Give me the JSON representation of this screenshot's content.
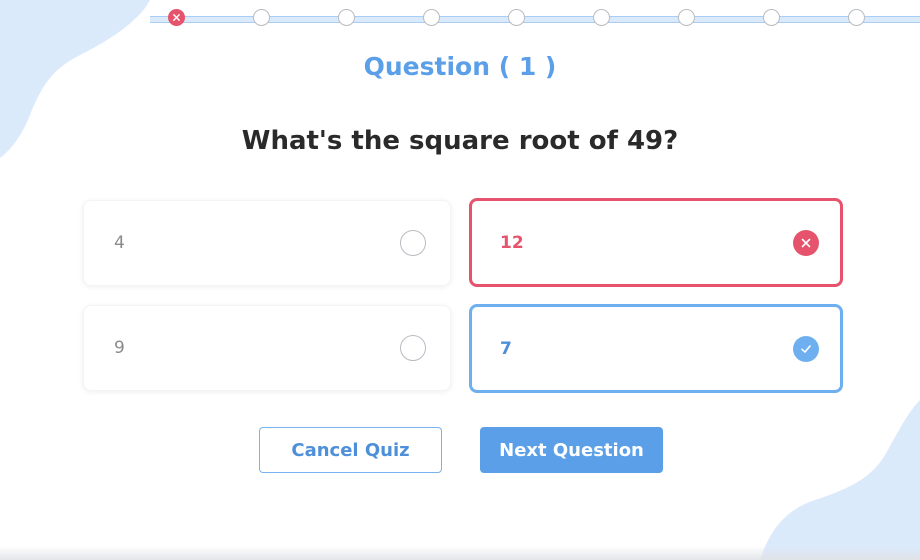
{
  "colors": {
    "accent": "#5a9fe8",
    "wrong": "#e5546c",
    "correct": "#6eb0ef",
    "blob": "#dbeafb"
  },
  "progress": {
    "current_step": 1,
    "total_steps": 9,
    "steps": [
      {
        "state": "wrong",
        "icon": "close-icon"
      },
      {
        "state": "pending"
      },
      {
        "state": "pending"
      },
      {
        "state": "pending"
      },
      {
        "state": "pending"
      },
      {
        "state": "pending"
      },
      {
        "state": "pending"
      },
      {
        "state": "pending"
      },
      {
        "state": "pending"
      }
    ]
  },
  "question": {
    "number_label": "Question ( 1 )",
    "text": "What's the square root of 49?"
  },
  "options": [
    {
      "label": "4",
      "state": "unselected"
    },
    {
      "label": "12",
      "state": "wrong",
      "icon": "close-icon"
    },
    {
      "label": "9",
      "state": "unselected"
    },
    {
      "label": "7",
      "state": "correct",
      "icon": "check-icon"
    }
  ],
  "buttons": {
    "cancel_label": "Cancel Quiz",
    "next_label": "Next Question"
  }
}
